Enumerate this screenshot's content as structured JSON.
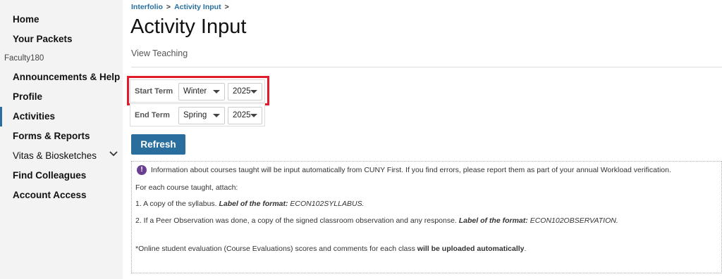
{
  "sidebar": {
    "home": "Home",
    "your_packets": "Your Packets",
    "section_label": "Faculty180",
    "announcements": "Announcements & Help",
    "profile": "Profile",
    "activities": "Activities",
    "forms_reports": "Forms & Reports",
    "vitas": "Vitas & Biosketches",
    "find_colleagues": "Find Colleagues",
    "account_access": "Account Access"
  },
  "breadcrumb": {
    "item1": "Interfolio",
    "item2": "Activity Input",
    "separator": ">"
  },
  "page": {
    "title": "Activity Input",
    "subtitle": "View Teaching"
  },
  "start_term": {
    "label": "Start Term",
    "season": "Winter",
    "year": "2025"
  },
  "end_term": {
    "label": "End Term",
    "season": "Spring",
    "year": "2025"
  },
  "refresh_button": "Refresh",
  "info": {
    "line1": "Information about courses taught will be input automatically from CUNY First. If you find errors, please report them as part of your annual Workload verification.",
    "line2": "For each course taught, attach:",
    "line3_prefix": "1. A copy of the syllabus. ",
    "line3_bold": "Label of the format:",
    "line3_italic": " ECON102SYLLABUS.",
    "line4_prefix": "2. If a Peer Observation was done, a copy of the signed classroom observation and any response. ",
    "line4_bold": "Label of the format:",
    "line4_italic": " ECON102OBSERVATION.",
    "line5_prefix": "*Online student evaluation (Course Evaluations) scores and comments for each class ",
    "line5_bold": "will be uploaded automatically",
    "line5_suffix": "."
  },
  "colors": {
    "accent": "#2a6e9e",
    "highlight": "#e01b2b",
    "info_icon": "#6b3f8f"
  }
}
